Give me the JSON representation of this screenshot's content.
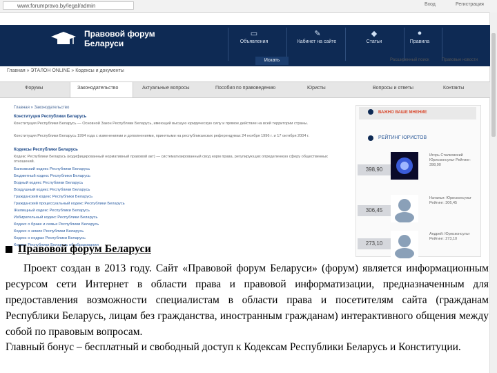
{
  "browser": {
    "url": "www.forumpravo.by/legal/admin",
    "top_links": [
      "Вход",
      "Регистрация"
    ]
  },
  "header": {
    "logo_line1": "Правовой форум",
    "logo_line2": "Беларуси",
    "menu": [
      "Объявления",
      "Кабинет на сайте",
      "Статьи",
      "Правила"
    ],
    "search_button": "Искать",
    "right_links": [
      "Расширенный поиск",
      "Правовые новости"
    ]
  },
  "breadcrumb": "Главная » ЭТАЛОН ONLINE » Кодексы и документы",
  "nav": {
    "items": [
      "Форумы",
      "Законодательство",
      "Актуальные вопросы",
      "Пособия по правоведению",
      "Юристы",
      "Вопросы и ответы",
      "Контакты"
    ]
  },
  "content": {
    "crumb": "Главная » Законодательство",
    "section1": "Конституция Республики Беларусь",
    "text1": "Конституция Республики Беларусь — Основной Закон Республики Беларусь, имеющий высшую юридическую силу и прямое действие на всей территории страны.",
    "text2": "Конституция Республики Беларусь 1994 года с изменениями и дополнениями, принятыми на республиканских референдумах 24 ноября 1996 г. и 17 октября 2004 г.",
    "section2": "Кодексы Республики Беларусь",
    "text3": "Кодекс Республики Беларусь (кодифицированный нормативный правовой акт) — систематизированный свод норм права, регулирующих определенную сферу общественных отношений.",
    "links": [
      "Банковский кодекс Республики Беларусь",
      "Бюджетный кодекс Республики Беларусь",
      "Водный кодекс Республики Беларусь",
      "Воздушный кодекс Республики Беларусь",
      "Гражданский кодекс Республики Беларусь",
      "Гражданский процессуальный кодекс Республики Беларусь",
      "Жилищный кодекс Республики Беларусь",
      "Избирательный кодекс Республики Беларусь",
      "Кодекс о браке и семье Республики Беларусь",
      "Кодекс о земле Республики Беларусь",
      "Кодекс о недрах Республики Беларусь",
      "Кодекс Республики Беларусь об образовании"
    ]
  },
  "sidebar": {
    "vote_label": "ВАЖНО ВАШЕ МНЕНИЕ",
    "rating_title": "РЕЙТИНГ ЮРИСТОВ",
    "users": [
      {
        "score": "398,90",
        "info": "Игорь Сталковский Юрисконсульт Рейтинг: 398,90"
      },
      {
        "score": "306,45",
        "info": "Наталья: Юрисконсульт Рейтинг: 306,45"
      },
      {
        "score": "273,10",
        "info": "Андрей: Юрисконсульт Рейтинг: 273,10"
      }
    ]
  },
  "overlay": {
    "title": "Правовой форум Беларуси",
    "paragraph1": "Проект создан в 2013 году. Сайт «Правовой форум Беларуси» (форум) является информационным ресурсом сети Интернет в области права и правовой информатизации, предназначенным для предоставления возможности специалистам в области права и посетителям сайта (гражданам Республики Беларусь, лицам без гражданства, иностранным гражданам) интерактивного общения между собой по правовым вопросам.",
    "paragraph2": "Главный бонус – бесплатный и свободный доступ к Кодексам Республики Беларусь и Конституции."
  },
  "colors": {
    "header_bg": "#0e2a54",
    "vote_text": "#d9472b"
  }
}
